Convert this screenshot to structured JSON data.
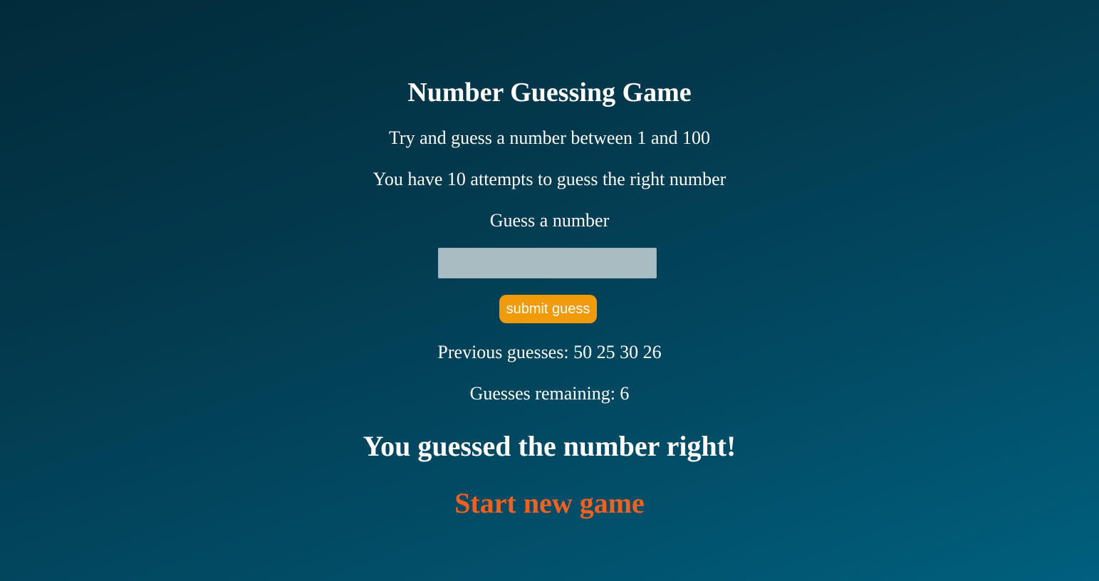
{
  "game": {
    "title": "Number Guessing Game",
    "instructions": "Try and guess a number between 1 and 100",
    "attempts_info": "You have 10 attempts to guess the right number",
    "guess_label": "Guess a number",
    "guess_input_value": "",
    "submit_label": "submit guess",
    "previous_guesses_label": "Previous guesses:",
    "previous_guesses": "50 25 30 26",
    "remaining_label": "Guesses remaining:",
    "remaining_count": "6",
    "result_message": "You guessed the number right!",
    "new_game_label": "Start new game"
  },
  "colors": {
    "background_start": "#022b3a",
    "background_end": "#00607e",
    "button": "#f19a0a",
    "new_game_link": "#f3601e",
    "input_background": "#a9bcc2"
  }
}
